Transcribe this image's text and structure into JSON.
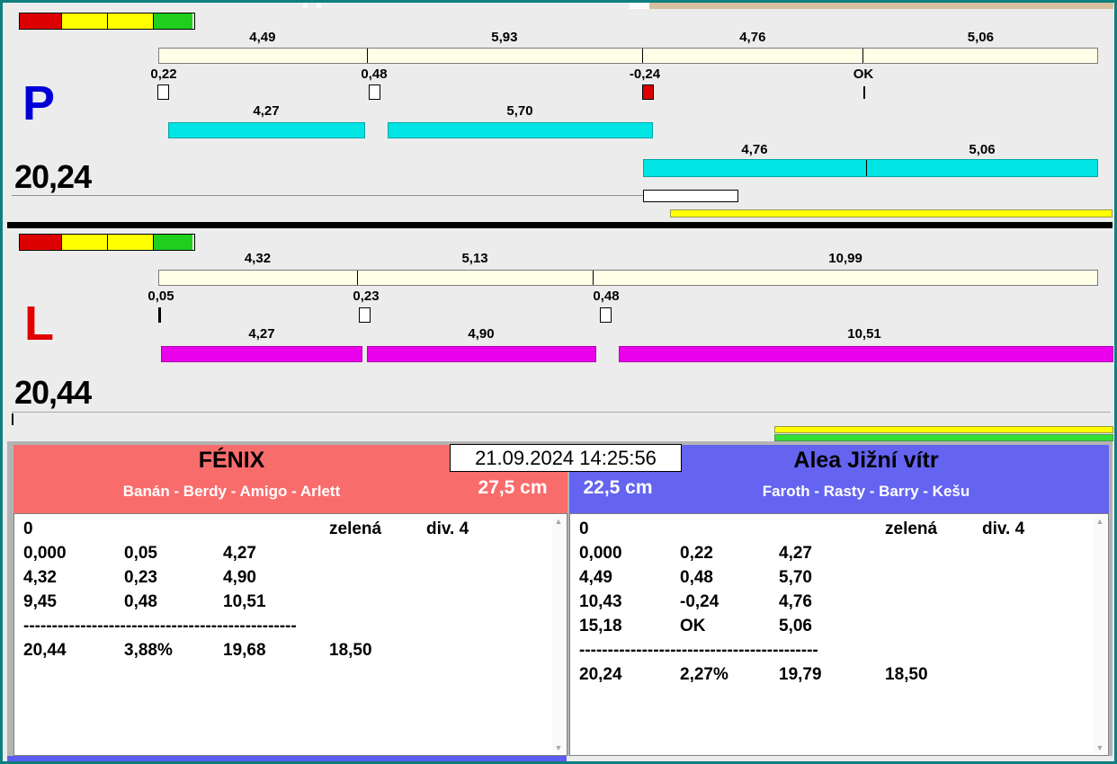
{
  "window": {
    "datetime": "21.09.2024 14:25:56"
  },
  "icons": {
    "scroll_up": "▲",
    "scroll_down": "▼"
  },
  "colors": {
    "cyan_bar": "#00e4e4",
    "magenta_bar": "#ea00ea",
    "scale_bar": "#ffffe8",
    "team_left_header": "#f96c6c",
    "team_right_header": "#6464f0",
    "status_red": "#dd0000",
    "status_yellow": "#ffff00",
    "status_green": "#1ecf1e",
    "progress_yellow": "#ffff00",
    "progress_green": "#35df35",
    "letter_p": "#0000d6",
    "letter_l": "#e00000"
  },
  "panel_p": {
    "letter": "P",
    "total": "20,24",
    "scale_labels": [
      "4,49",
      "5,93",
      "4,76",
      "5,06"
    ],
    "marker_labels": [
      "0,22",
      "0,48",
      "-0,24",
      "OK"
    ],
    "bar_labels_row1": [
      "4,27",
      "5,70"
    ],
    "bar_labels_row2": [
      "4,76",
      "5,06"
    ]
  },
  "panel_l": {
    "letter": "L",
    "total": "20,44",
    "scale_labels": [
      "4,32",
      "5,13",
      "10,99"
    ],
    "marker_labels": [
      "0,05",
      "0,23",
      "0,48"
    ],
    "bar_labels": [
      "4,27",
      "4,90",
      "10,51"
    ]
  },
  "team_left": {
    "name": "FÉNIX",
    "members": "Banán - Berdy - Amigo - Arlett",
    "distance": "27,5 cm",
    "rows": [
      [
        "0",
        "",
        "",
        "zelená",
        "div. 4"
      ],
      [
        "0,000",
        "0,05",
        "4,27",
        "",
        ""
      ],
      [
        "4,32",
        "0,23",
        "4,90",
        "",
        ""
      ],
      [
        "9,45",
        "0,48",
        "10,51",
        "",
        ""
      ],
      [
        "------------------------------------------------",
        "",
        "",
        "",
        ""
      ],
      [
        "20,44",
        "3,88%",
        "19,68",
        "18,50",
        ""
      ]
    ]
  },
  "team_right": {
    "name": "Alea Jižní vítr",
    "members": "Faroth - Rasty - Barry - Kešu",
    "distance": "22,5 cm",
    "rows": [
      [
        "0",
        "",
        "",
        "zelená",
        "div. 4"
      ],
      [
        "0,000",
        "0,22",
        "4,27",
        "",
        ""
      ],
      [
        "4,49",
        "0,48",
        "5,70",
        "",
        ""
      ],
      [
        "10,43",
        "-0,24",
        "4,76",
        "",
        ""
      ],
      [
        "15,18",
        "OK",
        "5,06",
        "",
        ""
      ],
      [
        "------------------------------------------",
        "",
        "",
        "",
        ""
      ],
      [
        "20,24",
        "2,27%",
        "19,79",
        "18,50",
        ""
      ]
    ]
  }
}
